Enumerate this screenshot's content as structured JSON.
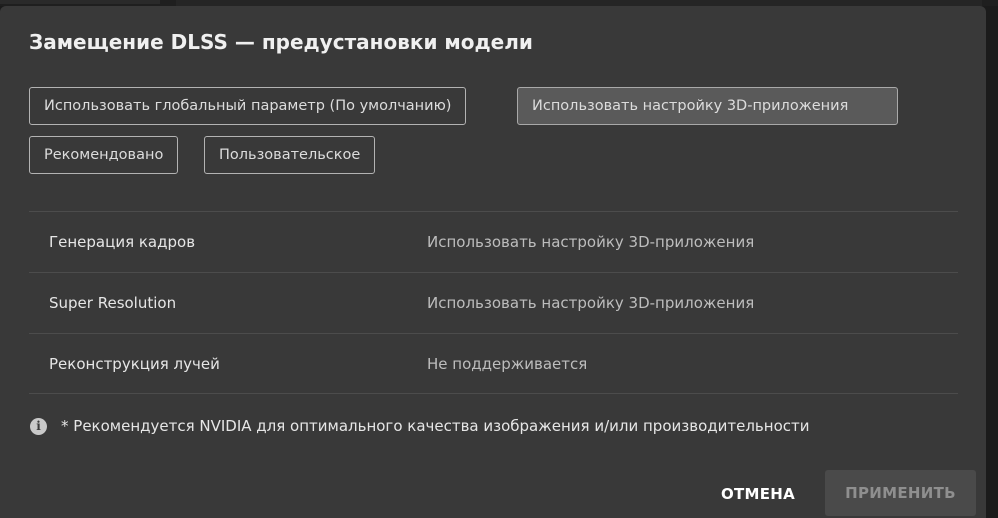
{
  "dialog": {
    "title": "Замещение DLSS — предустановки модели",
    "options": [
      {
        "label": "Использовать глобальный параметр (По умолчанию)",
        "selected": false
      },
      {
        "label": "Использовать настройку 3D-приложения",
        "selected": true
      },
      {
        "label": "Рекомендовано",
        "selected": false
      },
      {
        "label": "Пользовательское",
        "selected": false
      }
    ],
    "rows": [
      {
        "label": "Генерация кадров",
        "value": "Использовать настройку 3D-приложения"
      },
      {
        "label": "Super Resolution",
        "value": "Использовать настройку 3D-приложения"
      },
      {
        "label": "Реконструкция лучей",
        "value": "Не поддерживается"
      }
    ],
    "note": {
      "icon": "info-icon",
      "text": "* Рекомендуется NVIDIA для оптимального качества изображения и/или производительности"
    },
    "buttons": {
      "cancel": "ОТМЕНА",
      "apply": "ПРИМЕНИТЬ",
      "apply_enabled": false
    }
  },
  "colors": {
    "dialog_bg": "#393939",
    "selected_option_bg": "#5a5a5a",
    "disabled_button_bg": "#4a4a4a"
  }
}
